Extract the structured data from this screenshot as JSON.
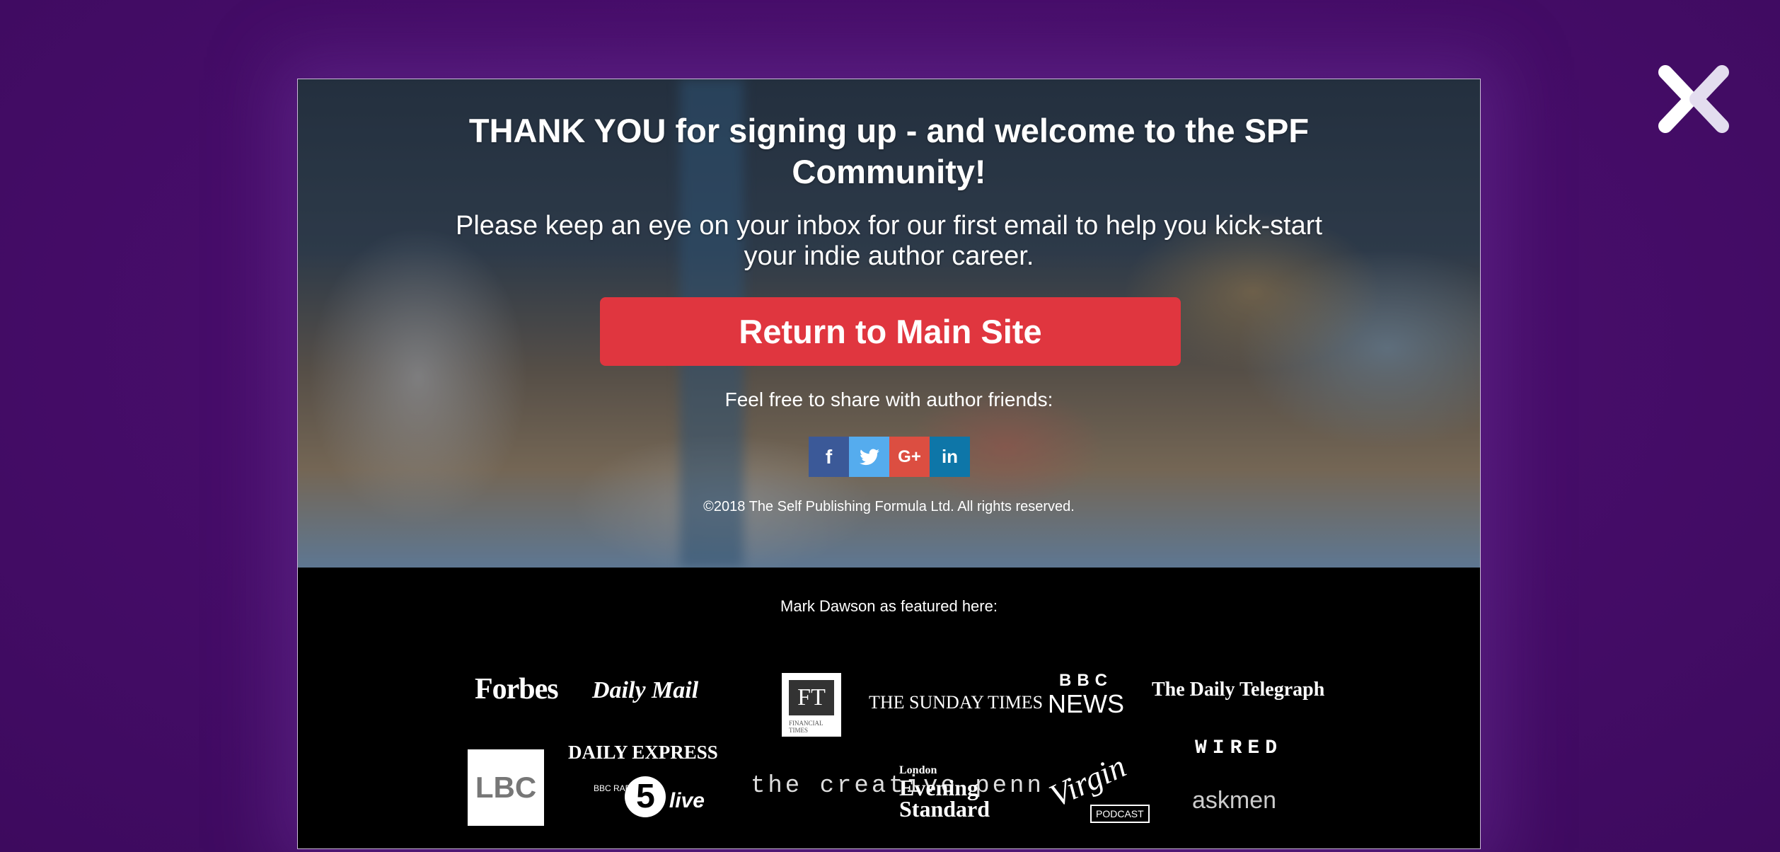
{
  "colors": {
    "background": "#460d69",
    "cta": "#e0363f",
    "facebook": "#3b5998",
    "twitter": "#55acee",
    "google_plus": "#dc4e41",
    "linkedin": "#0e76a8"
  },
  "close_icon": "close-x-icon",
  "hero": {
    "title": "THANK YOU for signing up - and welcome to the SPF Community!",
    "subtitle": "Please keep an eye on your inbox for our first email to help you kick-start your indie author career.",
    "cta_label": "Return to Main Site",
    "share_label": "Feel free to share with author friends:",
    "social": [
      {
        "icon": "facebook-icon",
        "glyph": "f"
      },
      {
        "icon": "twitter-icon",
        "glyph": "🐦"
      },
      {
        "icon": "google-plus-icon",
        "glyph": "G+"
      },
      {
        "icon": "linkedin-icon",
        "glyph": "in"
      }
    ],
    "copyright": "©2018 The Self Publishing Formula Ltd. All rights reserved."
  },
  "featured": {
    "label": "Mark Dawson as featured here:",
    "logos": [
      "Forbes",
      "Daily Mail",
      "FT",
      "FINANCIAL TIMES",
      "THE SUNDAY TIMES",
      "BBC",
      "NEWS",
      "The Daily Telegraph",
      "LBC",
      "DAILY EXPRESS",
      "BBC RADIO",
      "5",
      "live",
      "the creative penn",
      "London",
      "Evening Standard",
      "Virgin",
      "PODCAST",
      "WIRED",
      "askmen"
    ]
  }
}
